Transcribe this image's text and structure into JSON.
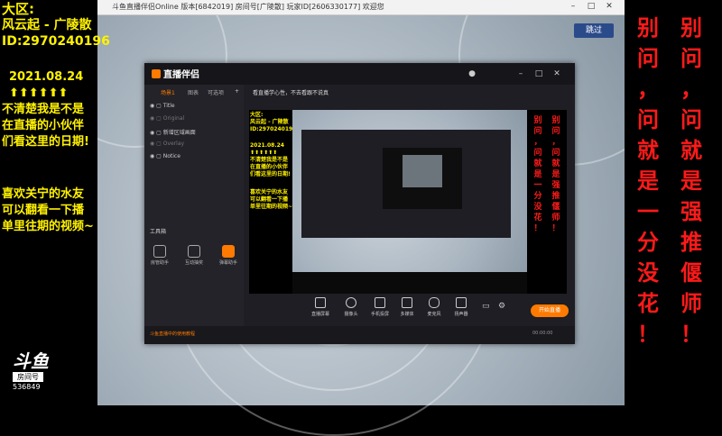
{
  "overlay_left": {
    "lines": [
      "大区:",
      "风云起 - 广陵散",
      "ID:2970240196",
      "2021.08.24",
      "⬆⬆⬆⬆⬆⬆",
      "不清楚我是不是",
      "在直播的小伙伴",
      "们看这里的日期!",
      "喜欢关宁的水友",
      "可以翻看一下播",
      "单里往期的视频~"
    ]
  },
  "overlay_right": {
    "col1": [
      "别",
      "问",
      "，",
      "问",
      "就",
      "是",
      "一",
      "分",
      "没",
      "花",
      "！"
    ],
    "col2": [
      "别",
      "问",
      "，",
      "问",
      "就",
      "是",
      "强",
      "推",
      "偃",
      "师",
      "！"
    ]
  },
  "window": {
    "title": "斗鱼直播伴侣Online 版本[6842019] 房间号[广陵散] 玩家ID[2606330177] 欢迎您",
    "skip_label": "跳过"
  },
  "app": {
    "logo": "直播伴侣",
    "sidebar_tabs": [
      "场景1",
      "图表",
      "可选项"
    ],
    "layers": [
      "Title",
      "Original",
      "新增区域画面",
      "Overlay",
      "Notice"
    ],
    "tools_title": "工具箱",
    "tools": [
      "房管助手",
      "互动抽奖",
      "弹幕助手"
    ],
    "topbar_text": "看直播学心性，不去看跟不说真",
    "preview_left": [
      "大区:",
      "风云起 - 广陵散",
      "ID:2970240196",
      "2021.08.24",
      "⬆⬆⬆⬆⬆⬆",
      "不清楚我是不是",
      "在直播的小伙伴",
      "们看这里的日期!",
      "喜欢关宁的水友",
      "可以翻看一下播",
      "单里往期的视频~"
    ],
    "preview_right_col1": [
      "别",
      "问",
      "，",
      "问",
      "就",
      "是",
      "一",
      "分",
      "没",
      "花",
      "！"
    ],
    "preview_right_col2": [
      "别",
      "问",
      "，",
      "问",
      "就",
      "是",
      "强",
      "推",
      "偃",
      "师",
      "！"
    ],
    "bottom_buttons": [
      "直播屏幕",
      "摄像头",
      "手机投屏",
      "多媒体",
      "麦克风",
      "扬声器"
    ],
    "go_live": "开始直播",
    "status_notice": "斗鱼直播中的使用教程",
    "status_time": "00:00:00"
  },
  "douyu": {
    "brand": "斗鱼",
    "room_label": "房间号",
    "room_number": "536849"
  }
}
